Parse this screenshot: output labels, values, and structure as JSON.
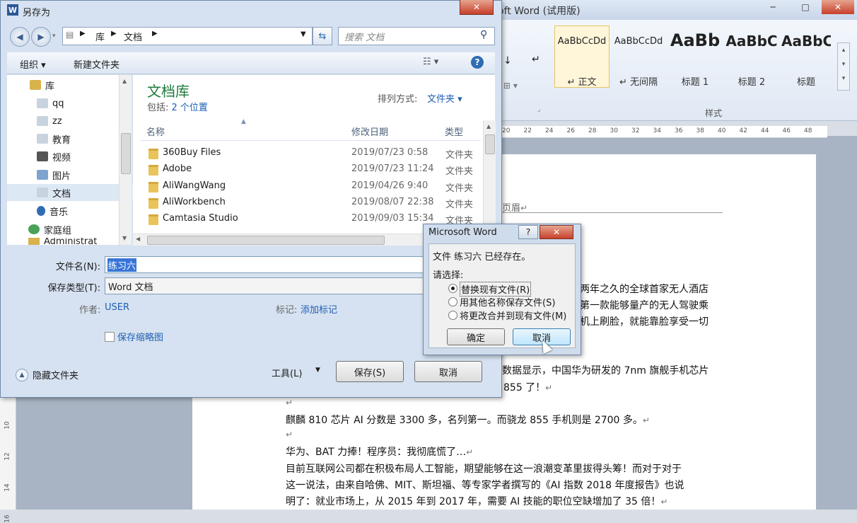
{
  "word": {
    "title": "oft Word (试用版)",
    "styles": [
      {
        "sample": "AaBbCcDd",
        "name": "↵ 正文"
      },
      {
        "sample": "AaBbCcDd",
        "name": "↵ 无间隔"
      },
      {
        "sample": "AaBb",
        "name": "标题 1"
      },
      {
        "sample": "AaBbC",
        "name": "标题 2"
      },
      {
        "sample": "AaBbC",
        "name": "标题"
      }
    ],
    "styles_group_label": "样式",
    "ruler_numbers": [
      "20",
      "22",
      "24",
      "26",
      "28",
      "30",
      "32",
      "34",
      "36",
      "38",
      "40",
      "42",
      "44",
      "46",
      "48"
    ],
    "vruler_numbers": [
      "10",
      "12",
      "14",
      "16"
    ],
    "header_label": "页眉",
    "doc_lines": [
      "两年之久的全球首家无人酒店",
      "第一款能够量产的无人驾驶乘",
      "机上刷脸，就能靠脸享受一切",
      "数据显示，中国华为研发的 7nm 旗舰手机芯片",
      "855 了！",
      "麒麟 810 芯片 AI 分数是 3300 多，名列第一。而骁龙 855 手机则是 2700 多。",
      "华为、BAT 力捧！程序员：我彻底慌了…",
      "目前互联网公司都在积极布局人工智能，期望能够在这一浪潮变革里拔得头筹！而对于对于",
      "这一说法，由来自哈佛、MIT、斯坦福、等专家学者撰写的《AI 指数 2018 年度报告》也说",
      "明了：就业市场上，从 2015 年到 2017 年，需要 AI 技能的职位空缺增加了 35 倍！"
    ]
  },
  "save_as": {
    "title": "另存为",
    "breadcrumb": [
      "库",
      "文档"
    ],
    "search_placeholder": "搜索 文档",
    "toolbar": {
      "organize": "组织 ▾",
      "new_folder": "新建文件夹"
    },
    "nav_items": [
      "库",
      "qq",
      "zz",
      "教育",
      "视频",
      "图片",
      "文档",
      "音乐",
      "家庭组",
      "Administrat"
    ],
    "library_title": "文档库",
    "library_sub_prefix": "包括: ",
    "library_sub_link": "2 个位置",
    "sort_label": "排列方式:",
    "sort_value": "文件夹 ▾",
    "columns": {
      "name": "名称",
      "date": "修改日期",
      "type": "类型"
    },
    "files": [
      {
        "name": "360Buy Files",
        "date": "2019/07/23 0:58",
        "type": "文件夹"
      },
      {
        "name": "Adobe",
        "date": "2019/07/23 11:24",
        "type": "文件夹"
      },
      {
        "name": "AliWangWang",
        "date": "2019/04/26 9:40",
        "type": "文件夹"
      },
      {
        "name": "AliWorkbench",
        "date": "2019/08/07 22:38",
        "type": "文件夹"
      },
      {
        "name": "Camtasia Studio",
        "date": "2019/09/03 15:34",
        "type": "文件夹"
      }
    ],
    "filename_label": "文件名(N):",
    "filename_value": "练习六",
    "filetype_label": "保存类型(T):",
    "filetype_value": "Word 文档",
    "author_label": "作者:",
    "author_value": "USER",
    "tags_label": "标记:",
    "tags_value": "添加标记",
    "thumbnail_label": "保存缩略图",
    "hide_folders": "隐藏文件夹",
    "tools": "工具(L)",
    "save": "保存(S)",
    "cancel": "取消"
  },
  "confirm": {
    "title": "Microsoft Word",
    "message": "文件 练习六 已经存在。",
    "prompt": "请选择:",
    "options": [
      "替换现有文件(R)",
      "用其他名称保存文件(S)",
      "将更改合并到现有文件(M)"
    ],
    "selected_option": 0,
    "ok": "确定",
    "cancel": "取消"
  },
  "colors": {
    "accent": "#1f5fb3",
    "library_title": "#1e7b3a",
    "selection": "#3875d7"
  }
}
